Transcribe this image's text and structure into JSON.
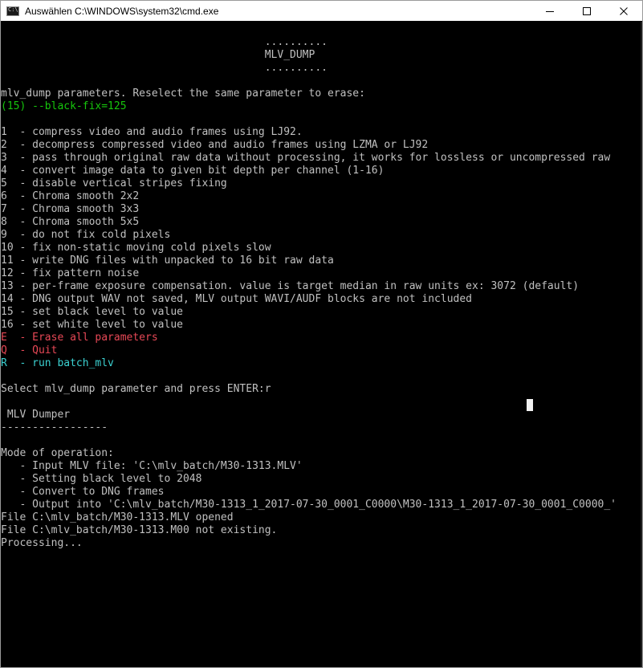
{
  "window": {
    "title": "Auswählen C:\\WINDOWS\\system32\\cmd.exe",
    "icon_label": "C:\\",
    "controls": [
      "minimize-icon",
      "maximize-icon",
      "close-icon"
    ]
  },
  "console": {
    "colors": {
      "default": "#c0c0c0",
      "green": "#16c60c",
      "red": "#e74856",
      "cyan": "#3bd1d1",
      "background": "#000000"
    },
    "lines": [
      {
        "text": "                                          .........."
      },
      {
        "text": "                                          MLV_DUMP"
      },
      {
        "text": "                                          .........."
      },
      {
        "text": ""
      },
      {
        "text": "mlv_dump parameters. Reselect the same parameter to erase:"
      },
      {
        "text": "(15) --black-fix=125",
        "color": "green"
      },
      {
        "text": ""
      },
      {
        "text": "1  - compress video and audio frames using LJ92."
      },
      {
        "text": "2  - decompress compressed video and audio frames using LZMA or LJ92"
      },
      {
        "text": "3  - pass through original raw data without processing, it works for lossless or uncompressed raw"
      },
      {
        "text": "4  - convert image data to given bit depth per channel (1-16)"
      },
      {
        "text": "5  - disable vertical stripes fixing"
      },
      {
        "text": "6  - Chroma smooth 2x2"
      },
      {
        "text": "7  - Chroma smooth 3x3"
      },
      {
        "text": "8  - Chroma smooth 5x5"
      },
      {
        "text": "9  - do not fix cold pixels"
      },
      {
        "text": "10 - fix non-static moving cold pixels slow"
      },
      {
        "text": "11 - write DNG files with unpacked to 16 bit raw data"
      },
      {
        "text": "12 - fix pattern noise"
      },
      {
        "text": "13 - per-frame exposure compensation. value is target median in raw units ex: 3072 (default)"
      },
      {
        "text": "14 - DNG output WAV not saved, MLV output WAVI/AUDF blocks are not included"
      },
      {
        "text": "15 - set black level to value"
      },
      {
        "text": "16 - set white level to value"
      },
      {
        "text": "E  - Erase all parameters",
        "color": "red"
      },
      {
        "text": "Q  - Quit",
        "color": "red"
      },
      {
        "text": "R  - run batch_mlv",
        "color": "cyan"
      },
      {
        "text": ""
      },
      {
        "text": "Select mlv_dump parameter and press ENTER:r"
      },
      {
        "text": ""
      },
      {
        "text": " MLV Dumper"
      },
      {
        "text": "-----------------"
      },
      {
        "text": ""
      },
      {
        "text": "Mode of operation:"
      },
      {
        "text": "   - Input MLV file: 'C:\\mlv_batch/M30-1313.MLV'"
      },
      {
        "text": "   - Setting black level to 2048"
      },
      {
        "text": "   - Convert to DNG frames"
      },
      {
        "text": "   - Output into 'C:\\mlv_batch/M30-1313_1_2017-07-30_0001_C0000\\M30-1313_1_2017-07-30_0001_C0000_'"
      },
      {
        "text": "File C:\\mlv_batch/M30-1313.MLV opened"
      },
      {
        "text": "File C:\\mlv_batch/M30-1313.M00 not existing."
      },
      {
        "text": "Processing..."
      }
    ]
  }
}
